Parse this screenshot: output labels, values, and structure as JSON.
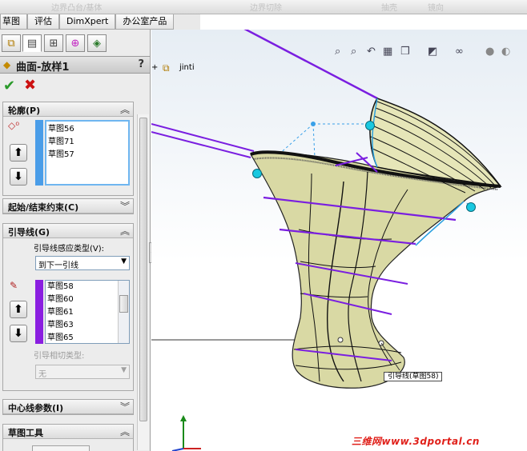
{
  "top_toolbar": {
    "ghost_items": [
      "边界凸台/基体",
      "边界切除",
      "抽壳",
      "镜向"
    ]
  },
  "command_tabs": [
    "草图",
    "评估",
    "DimXpert",
    "办公室产品"
  ],
  "property_manager": {
    "title": "曲面-放样1",
    "help": "?",
    "ok_label": "✔",
    "cancel_label": "✖",
    "groups": {
      "profiles": {
        "label": "轮廓(P)",
        "items": [
          "草图56",
          "草图71",
          "草图57"
        ],
        "color": "#4a9de8"
      },
      "constraints": {
        "label": "起始/结束约束(C)"
      },
      "guides": {
        "label": "引导线(G)",
        "influence_label": "引导线感应类型(V):",
        "influence_value": "到下一引线",
        "items": [
          "草图58",
          "草图60",
          "草图61",
          "草图63",
          "草图65"
        ],
        "color": "#8a1ee0",
        "tangency_label": "引导相切类型:",
        "tangency_value": "无"
      },
      "centerline": {
        "label": "中心线参数(I)"
      },
      "sketch_tools": {
        "label": "草图工具"
      }
    }
  },
  "tree": {
    "expander": "+",
    "part_name": "jinti"
  },
  "viewport": {
    "callout": "引导线(草图58)",
    "watermark": "三维网www.3dportal.cn"
  },
  "colors": {
    "guide_line": "#7a1ee0",
    "profile_line": "#2aa0e0",
    "surface": "#d8d9a0",
    "handle": "#18c8e0"
  }
}
